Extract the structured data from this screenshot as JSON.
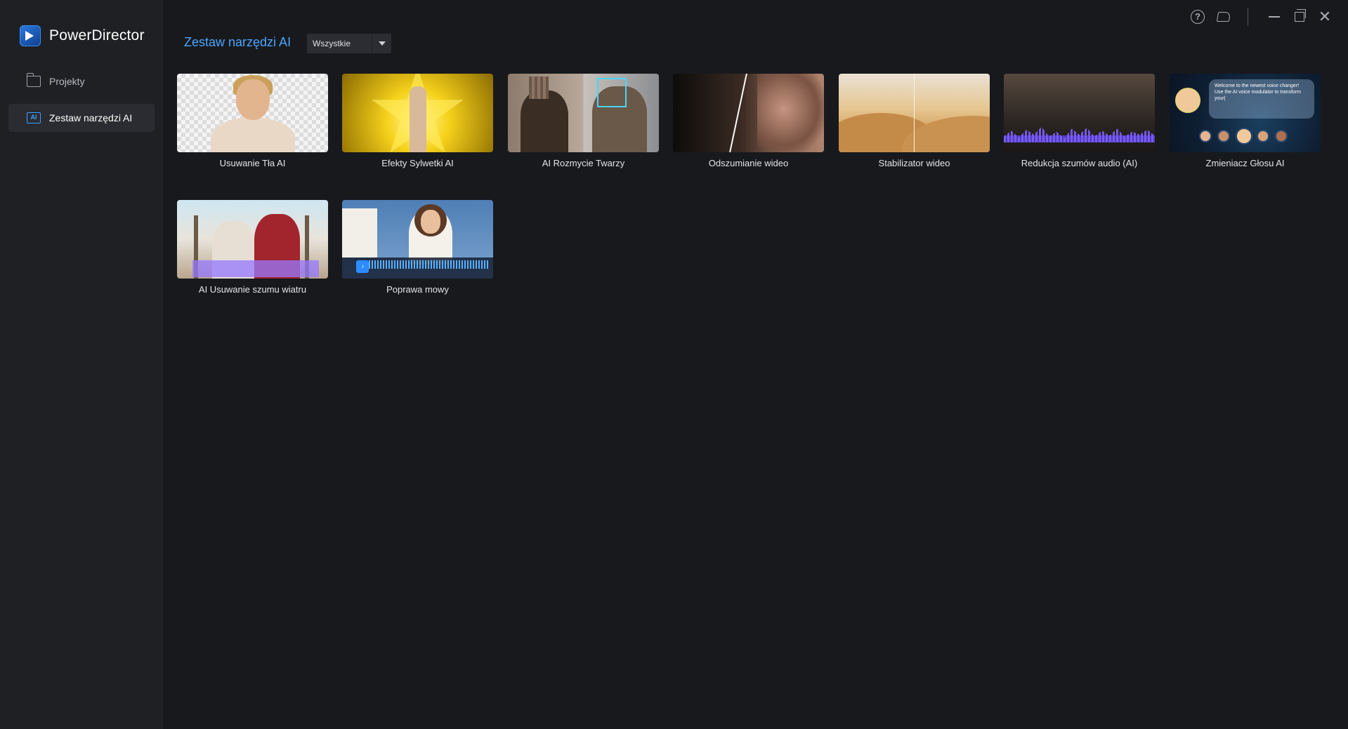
{
  "app": {
    "name": "PowerDirector"
  },
  "sidebar": {
    "items": [
      {
        "label": "Projekty",
        "icon": "folder-icon",
        "active": false
      },
      {
        "label": "Zestaw narzędzi AI",
        "icon": "ai-toolkit-icon",
        "active": true
      }
    ]
  },
  "header": {
    "title": "Zestaw narzędzi AI",
    "filter": {
      "selected": "Wszystkie"
    }
  },
  "window_controls": [
    "help-icon",
    "feedback-icon",
    "minimize-icon",
    "maximize-icon",
    "close-icon"
  ],
  "tools": [
    {
      "label": "Usuwanie Tła AI"
    },
    {
      "label": "Efekty Sylwetki AI"
    },
    {
      "label": "AI Rozmycie Twarzy"
    },
    {
      "label": "Odszumianie wideo"
    },
    {
      "label": "Stabilizator wideo"
    },
    {
      "label": "Redukcja szumów audio (AI)"
    },
    {
      "label": "Zmieniacz Głosu AI",
      "thumb_text": "Welcome to the newest voice changer! Use the AI voice modulator to transform your|"
    },
    {
      "label": "AI Usuwanie szumu wiatru"
    },
    {
      "label": "Poprawa mowy"
    }
  ],
  "colors": {
    "accent": "#4aa6ff",
    "background": "#18191d",
    "sidebar": "#1f2024",
    "active_item": "#2b2c31"
  }
}
